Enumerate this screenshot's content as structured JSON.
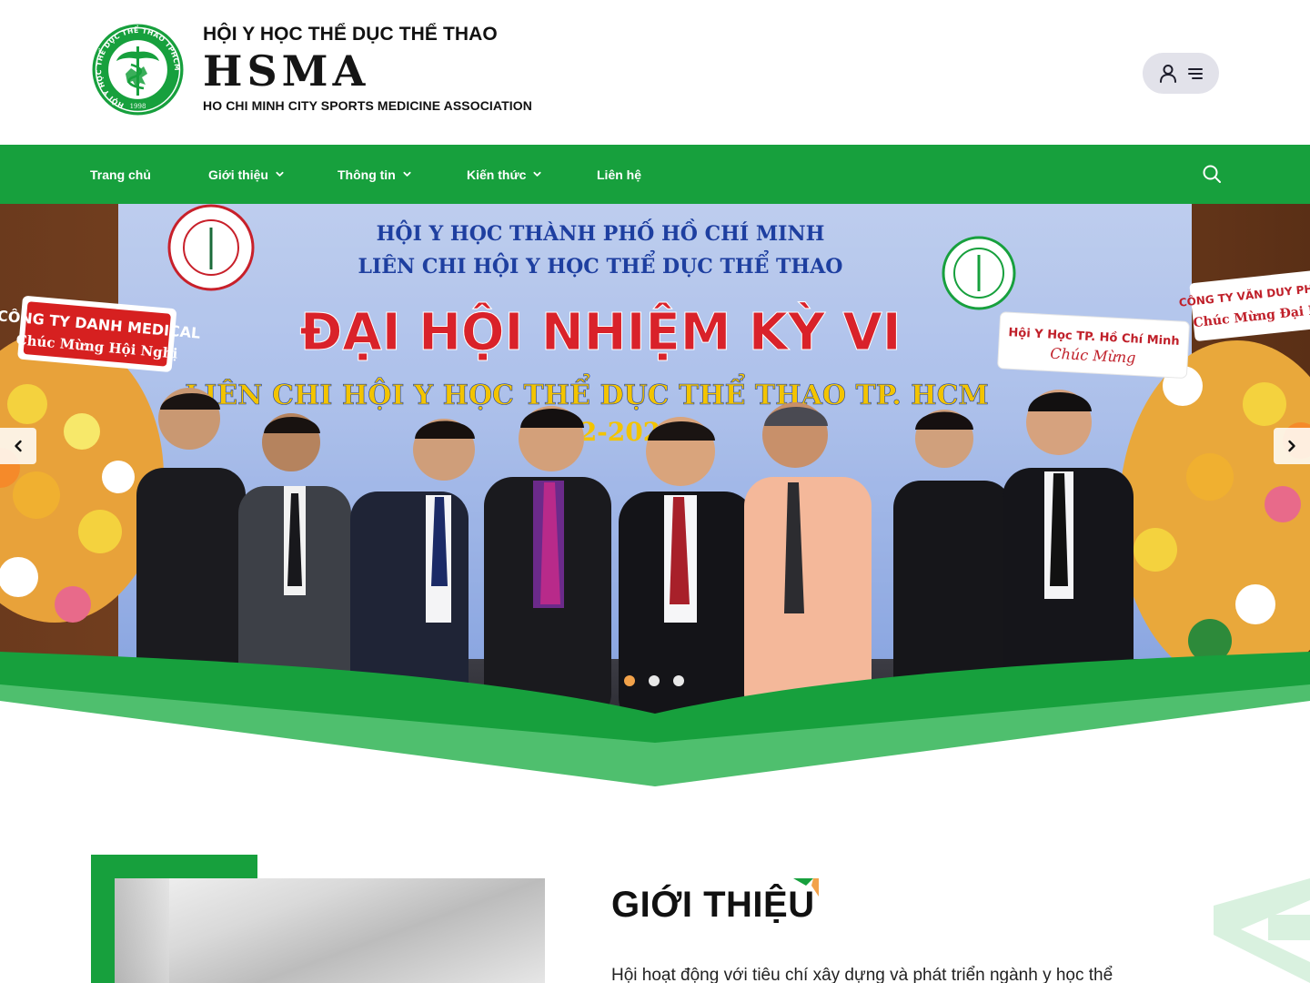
{
  "header": {
    "org_name_vn": "HỘI Y HỌC THỂ DỤC THỂ THAO",
    "org_abbr": "HSMA",
    "org_name_en": "HO CHI MINH CITY SPORTS MEDICINE ASSOCIATION",
    "logo": {
      "ring_text": "HỘI Y HỌC THỂ DỤC THỂ THAO TPHCM",
      "year": "1998"
    },
    "icons": [
      "user-icon",
      "menu-icon"
    ]
  },
  "nav": {
    "items": [
      {
        "label": "Trang chủ",
        "has_dropdown": false
      },
      {
        "label": "Giới thiệu",
        "has_dropdown": true
      },
      {
        "label": "Thông tin",
        "has_dropdown": true
      },
      {
        "label": "Kiến thức",
        "has_dropdown": true
      },
      {
        "label": "Liên hệ",
        "has_dropdown": false
      }
    ],
    "search_icon": "search-icon"
  },
  "hero": {
    "banner_line1": "HỘI Y HỌC THÀNH PHỐ HỒ CHÍ MINH",
    "banner_line2": "LIÊN CHI HỘI Y HỌC THỂ DỤC THỂ THAO",
    "banner_headline": "ĐẠI HỘI NHIỆM KỲ VI",
    "banner_subheadline": "LIÊN CHI HỘI Y HỌC THỂ DỤC THỂ THAO TP. HCM",
    "banner_years": "2022-2027",
    "banner_logo_text": "HỘI Y HỌC TP. HỒ CHÍ MINH",
    "flower_sign_left_1": "CÔNG TY DANH MEDICAL",
    "flower_sign_left_2": "Chúc Mừng Hội Nghị",
    "flower_sign_mid_1": "Hội Y Học TP. Hồ Chí Minh",
    "flower_sign_mid_2": "Chúc Mừng",
    "flower_sign_right_1": "CÔNG TY VĂN DUY PHÚC",
    "flower_sign_right_2": "Chúc Mừng Đại H",
    "slide_count": 3,
    "active_slide": 1,
    "prev_icon": "chevron-left-icon",
    "next_icon": "chevron-right-icon"
  },
  "about": {
    "title": "GIỚI THIỆU",
    "text": "Hội hoạt động với tiêu chí xây dựng và phát triển ngành y học thể"
  },
  "colors": {
    "brand_green": "#17a03d",
    "light_green": "#4fbf6e",
    "accent_orange": "#f2a24a",
    "banner_blue": "#1e3fa0",
    "banner_red": "#d9222a",
    "banner_yellow": "#f3c400"
  }
}
